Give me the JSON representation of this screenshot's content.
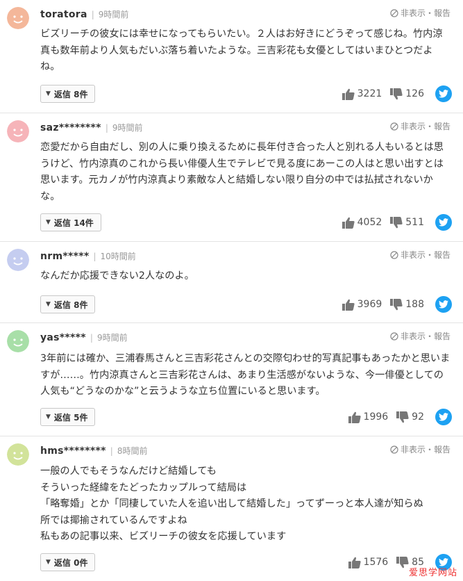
{
  "ui": {
    "report_label": "非表示・報告"
  },
  "comments": [
    {
      "user": "toratora",
      "time": "9時間前",
      "avatar_color": "#f4b79a",
      "text": "ビズリーチの彼女には幸せになってもらいたい。２人はお好きにどうぞって感じね。竹内涼真も数年前より人気もだいぶ落ち着いたような。三吉彩花も女優としてはいまひとつだよね。",
      "reply": "返信 8件",
      "likes": "3221",
      "dislikes": "126"
    },
    {
      "user": "saz********",
      "time": "9時間前",
      "avatar_color": "#f6b4b9",
      "text": "恋愛だから自由だし、別の人に乗り換えるために長年付き合った人と別れる人もいるとは思うけど、竹内涼真のこれから長い俳優人生でテレビで見る度にあーこの人はと思い出すとは思います。元カノが竹内涼真より素敵な人と結婚しない限り自分の中では払拭されないかな。",
      "reply": "返信 14件",
      "likes": "4052",
      "dislikes": "511"
    },
    {
      "user": "nrm*****",
      "time": "10時間前",
      "avatar_color": "#c5cdf0",
      "text": "なんだか応援できない2人なのよ。",
      "reply": "返信 8件",
      "likes": "3969",
      "dislikes": "188"
    },
    {
      "user": "yas*****",
      "time": "9時間前",
      "avatar_color": "#a8dfa8",
      "text": "3年前には確か、三浦春馬さんと三吉彩花さんとの交際匂わせ的写真記事もあったかと思いますが……。竹内涼真さんと三吉彩花さんは、あまり生活感がないような、今一俳優としての人気も“どうなのかな”と云うような立ち位置にいると思います。",
      "reply": "返信 5件",
      "likes": "1996",
      "dislikes": "92"
    },
    {
      "user": "hms********",
      "time": "8時間前",
      "avatar_color": "#d2e39a",
      "text_lines": [
        "一般の人でもそうなんだけど結婚しても",
        "そういった経緯をたどったカップルって結局は",
        "「略奪婚」とか「同棲していた人を追い出して結婚した」ってずーっと本人達が知らぬ",
        "所では揶揄されているんですよね",
        "私もあの記事以来、ビズリーチの彼女を応援しています"
      ],
      "reply": "返信 0件",
      "likes": "1576",
      "dislikes": "85"
    }
  ],
  "watermark": "爱思学网站"
}
